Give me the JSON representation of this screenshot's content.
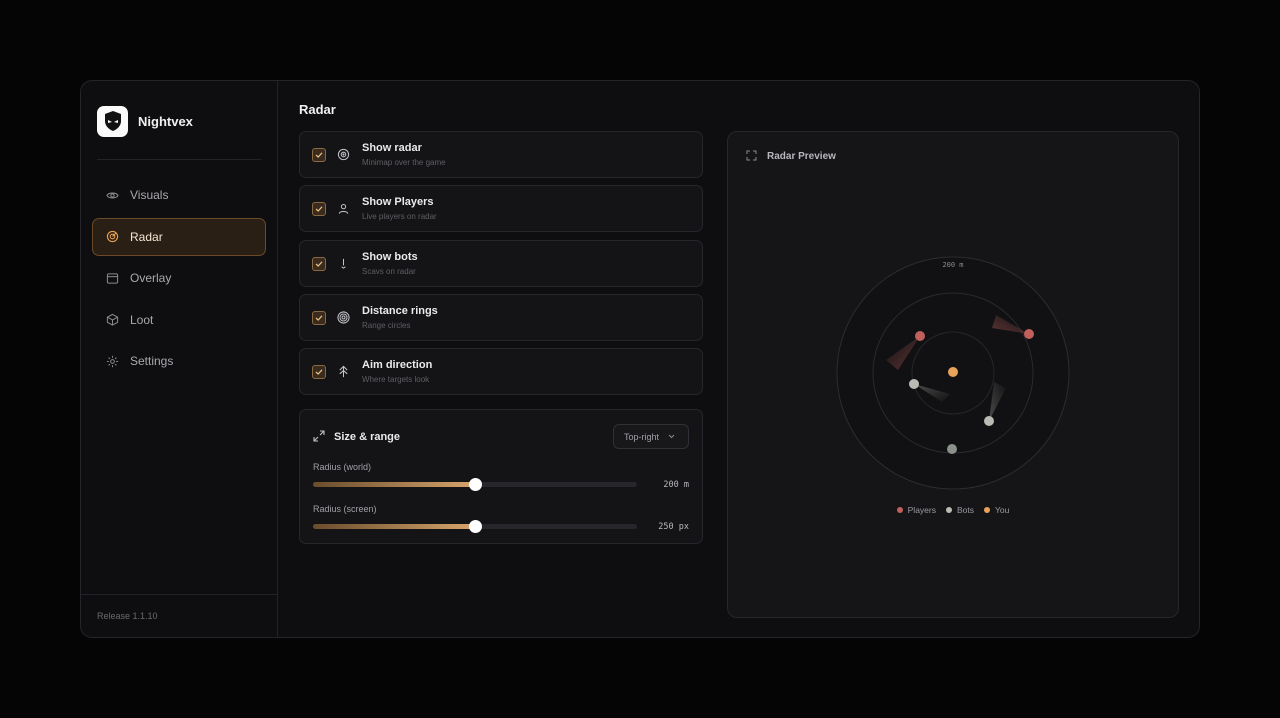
{
  "app": {
    "name": "Nightvex",
    "release": "Release 1.1.10"
  },
  "nav": [
    {
      "label": "Visuals",
      "icon": "eye-icon",
      "active": false
    },
    {
      "label": "Radar",
      "icon": "radar-icon",
      "active": true
    },
    {
      "label": "Overlay",
      "icon": "window-icon",
      "active": false
    },
    {
      "label": "Loot",
      "icon": "box-icon",
      "active": false
    },
    {
      "label": "Settings",
      "icon": "gear-icon",
      "active": false
    }
  ],
  "page": {
    "title": "Radar"
  },
  "options": [
    {
      "title": "Show radar",
      "subtitle": "Minimap over the game",
      "checked": true,
      "icon": "target-icon"
    },
    {
      "title": "Show Players",
      "subtitle": "Live players on radar",
      "checked": true,
      "icon": "user-icon"
    },
    {
      "title": "Show bots",
      "subtitle": "Scavs on radar",
      "checked": true,
      "icon": "bot-icon"
    },
    {
      "title": "Distance rings",
      "subtitle": "Range circles",
      "checked": true,
      "icon": "rings-icon"
    },
    {
      "title": "Aim direction",
      "subtitle": "Where targets look",
      "checked": true,
      "icon": "arrow-up-icon"
    }
  ],
  "size_range": {
    "title": "Size & range",
    "position": "Top-right",
    "sliders": [
      {
        "label": "Radius (world)",
        "value_text": "200 m",
        "fraction": 0.5
      },
      {
        "label": "Radius (screen)",
        "value_text": "250 px",
        "fraction": 0.5
      }
    ]
  },
  "preview": {
    "title": "Radar Preview",
    "range_label": "200 m",
    "legend": [
      {
        "label": "Players",
        "color": "#c0605c"
      },
      {
        "label": "Bots",
        "color": "#b9bcb2"
      },
      {
        "label": "You",
        "color": "#e8a25a"
      }
    ]
  },
  "colors": {
    "accent": "#d7a56c",
    "player": "#c0605c",
    "bot": "#b9bcb2",
    "you": "#e8a25a"
  }
}
